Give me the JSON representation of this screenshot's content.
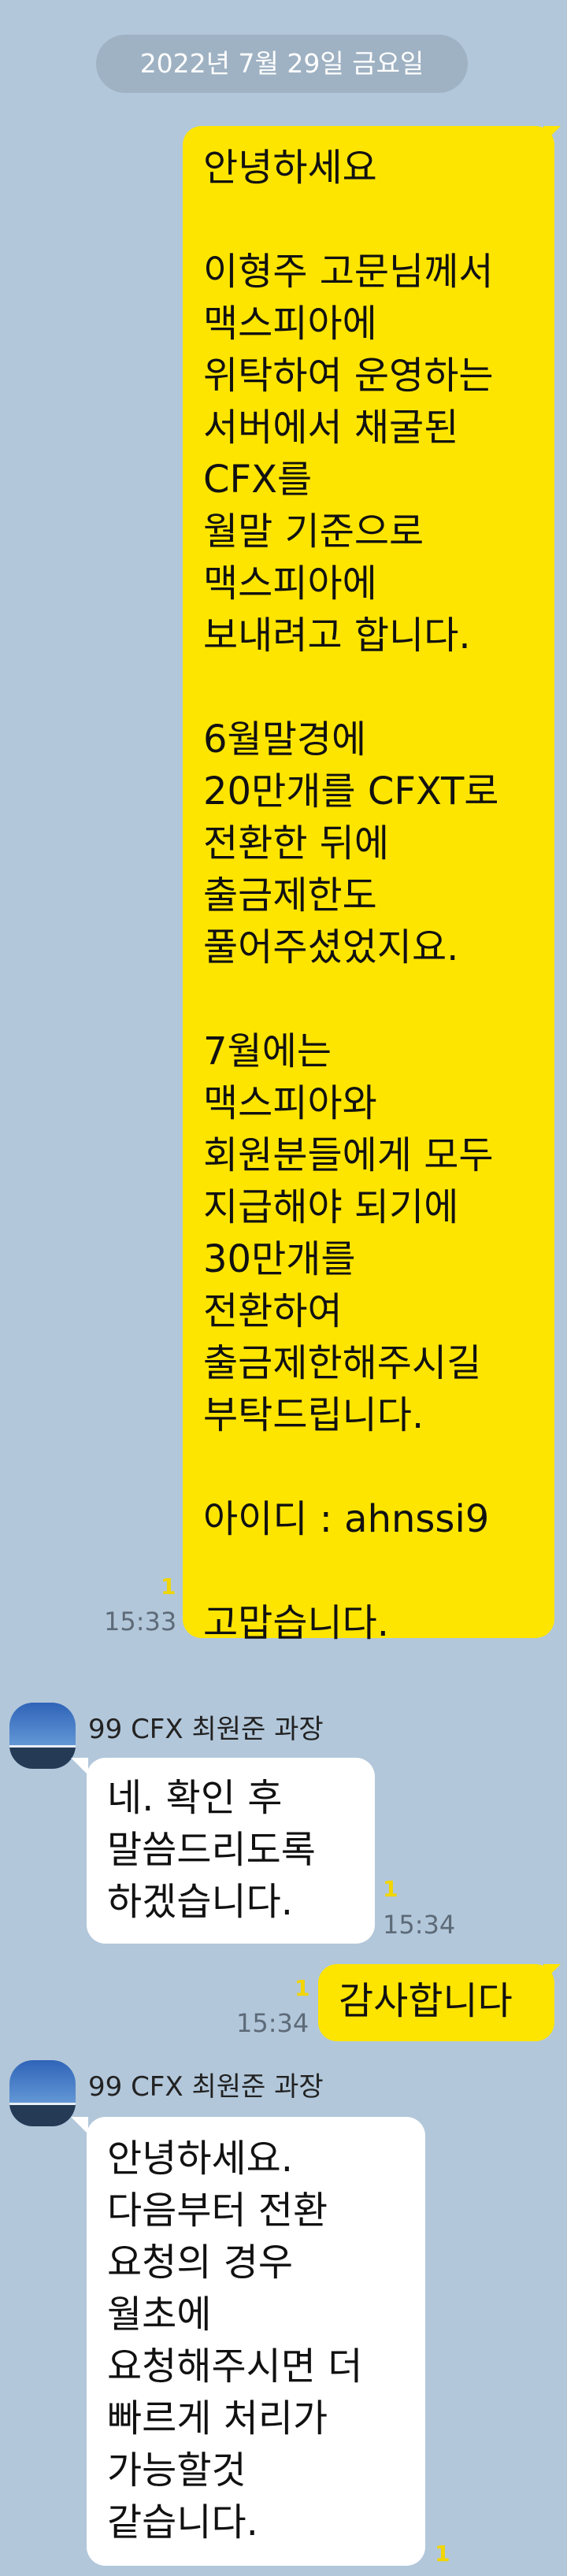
{
  "date_divider": "2022년 7월 29일 금요일",
  "messages": [
    {
      "text": "안녕하세요\n\n이형주 고문님께서\n맥스피아에\n위탁하여 운영하는\n서버에서 채굴된\nCFX를\n월말 기준으로\n맥스피아에\n보내려고 합니다.\n\n6월말경에\n20만개를 CFXT로\n전환한 뒤에\n출금제한도\n풀어주셨었지요.\n\n7월에는\n맥스피아와\n회원분들에게 모두\n지급해야 되기에\n30만개를\n전환하여\n출금제한해주시길\n부탁드립니다.\n\n아이디 : ahnssi9\n\n고맙습니다.",
      "unread": "1",
      "time": "15:33"
    },
    {
      "sender": "99 CFX 최원준 과장",
      "text": "네. 확인 후\n말씀드리도록\n하겠습니다.",
      "unread": "1",
      "time": "15:34"
    },
    {
      "text": "감사합니다",
      "unread": "1",
      "time": "15:34"
    },
    {
      "sender": "99 CFX 최원준 과장",
      "text": "안녕하세요.\n다음부터 전환\n요청의 경우\n월초에\n요청해주시면 더\n빠르게 처리가\n가능할것\n같습니다.",
      "unread": "1"
    }
  ],
  "colors": {
    "background": "#b2c7da",
    "my_bubble": "#fee500",
    "their_bubble": "#ffffff",
    "unread": "#f2d600"
  }
}
